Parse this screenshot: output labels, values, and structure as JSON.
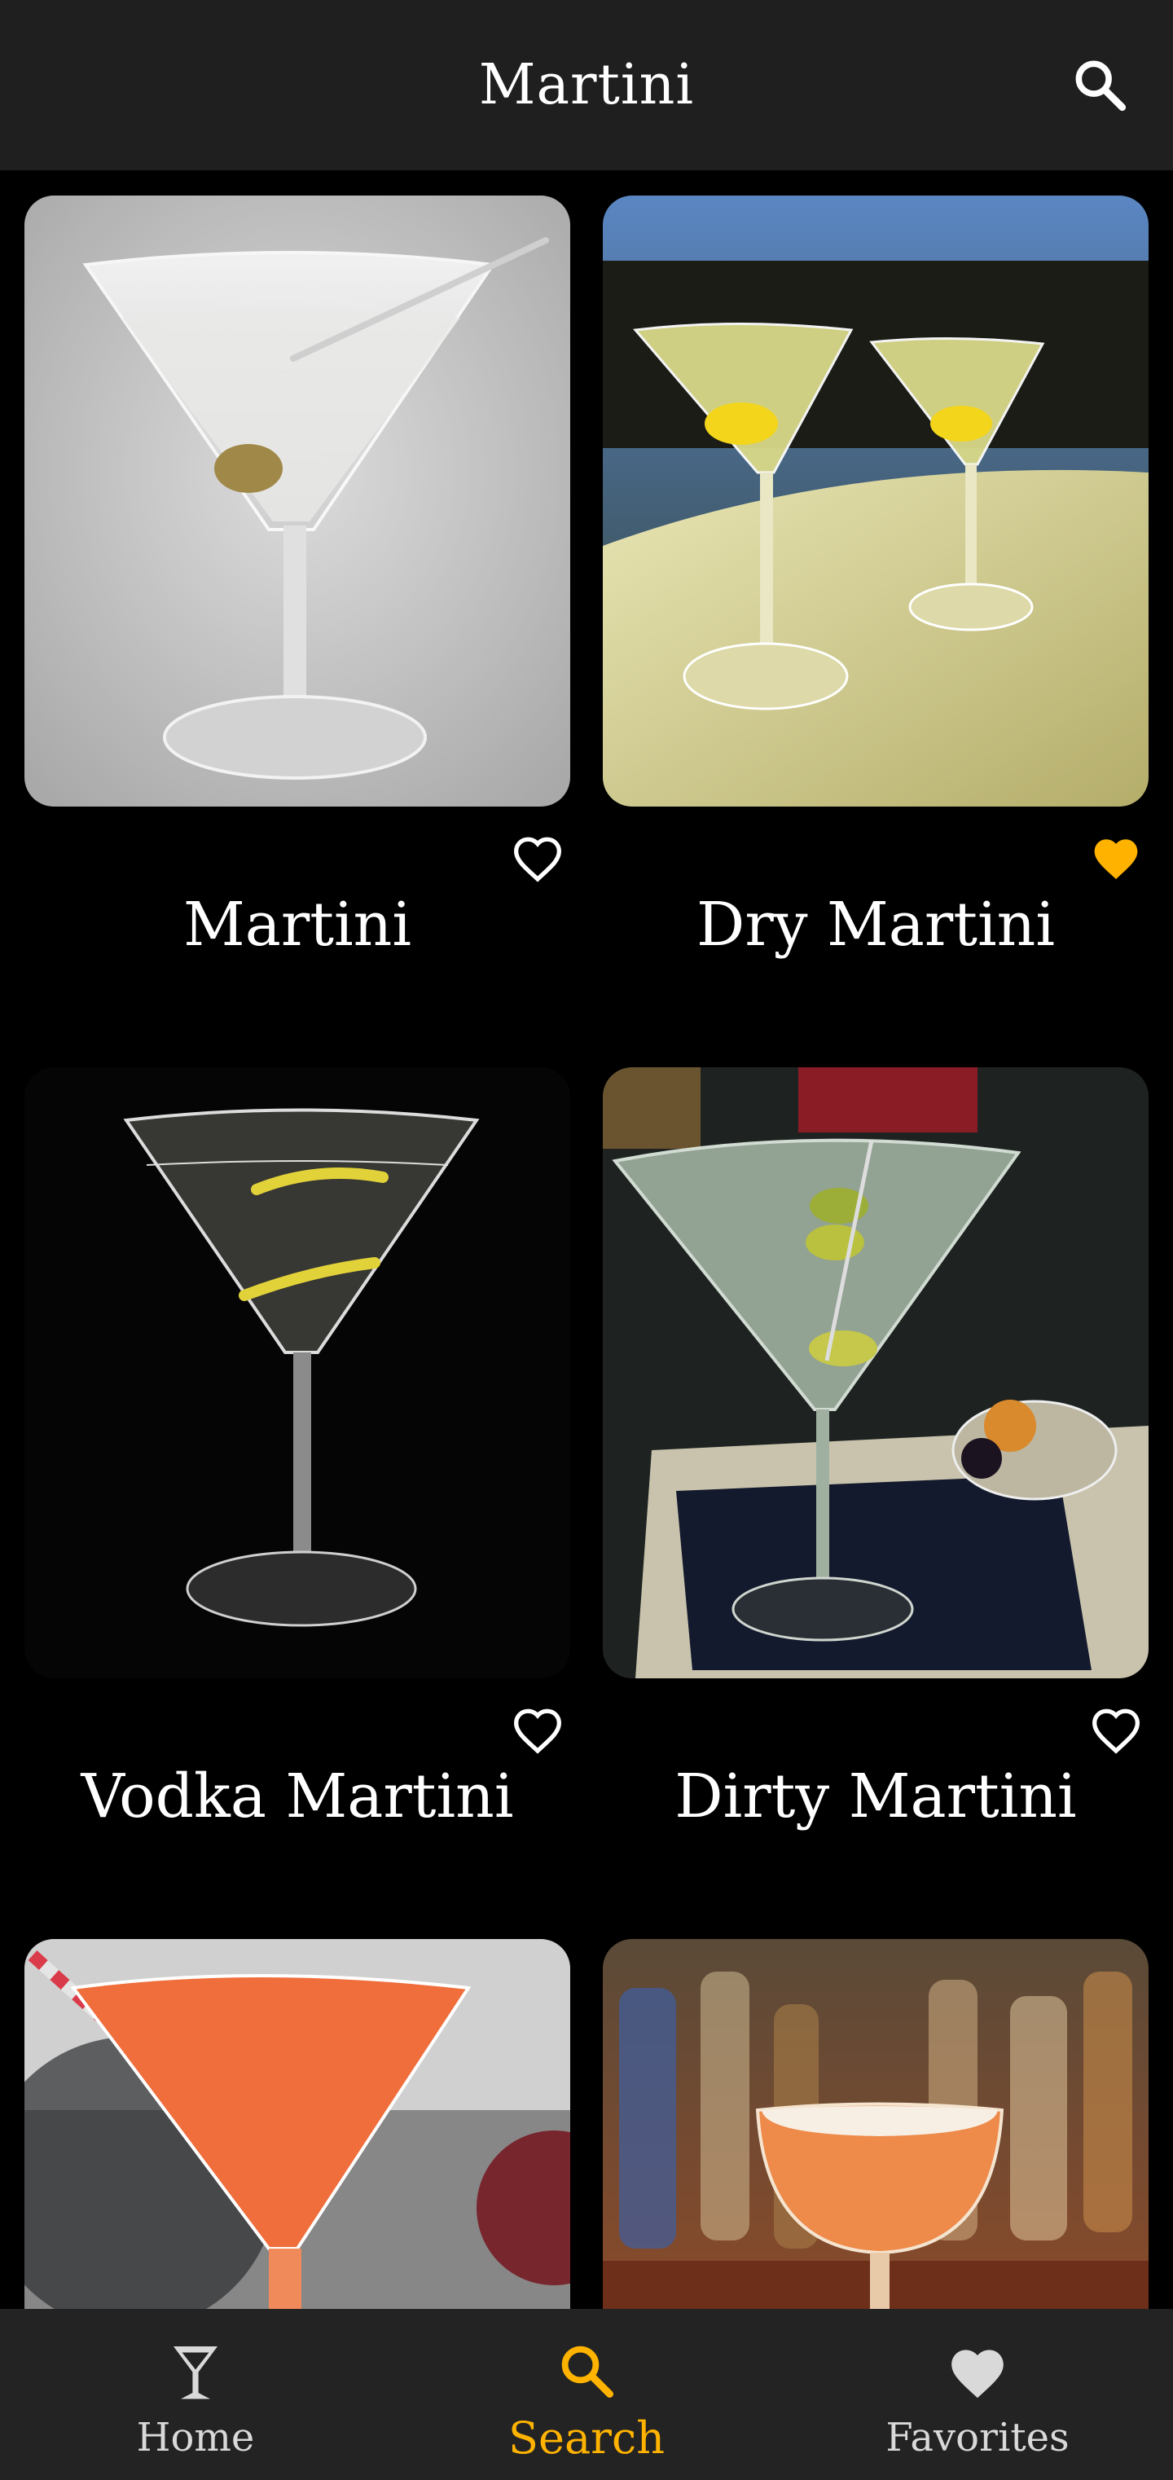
{
  "header": {
    "title": "Martini",
    "search_icon": "search-icon"
  },
  "cards": [
    {
      "name": "Martini",
      "favorite": false,
      "favorite_icon": "heart-outline-icon"
    },
    {
      "name": "Dry Martini",
      "favorite": true,
      "favorite_icon": "heart-filled-icon"
    },
    {
      "name": "Vodka Martini",
      "favorite": false,
      "favorite_icon": "heart-outline-icon"
    },
    {
      "name": "Dirty Martini",
      "favorite": false,
      "favorite_icon": "heart-outline-icon"
    },
    {
      "name": "",
      "favorite": false
    },
    {
      "name": "",
      "favorite": false
    }
  ],
  "bottom_nav": {
    "items": [
      {
        "label": "Home",
        "icon": "cocktail-glass-icon",
        "active": false
      },
      {
        "label": "Search",
        "icon": "search-icon",
        "active": true
      },
      {
        "label": "Favorites",
        "icon": "heart-icon",
        "active": false
      }
    ]
  },
  "colors": {
    "accent": "#FFB300",
    "app_bar": "#1F1F1F",
    "background": "#000000",
    "nav_bar": "#232323",
    "inactive": "#D9D9D9"
  }
}
